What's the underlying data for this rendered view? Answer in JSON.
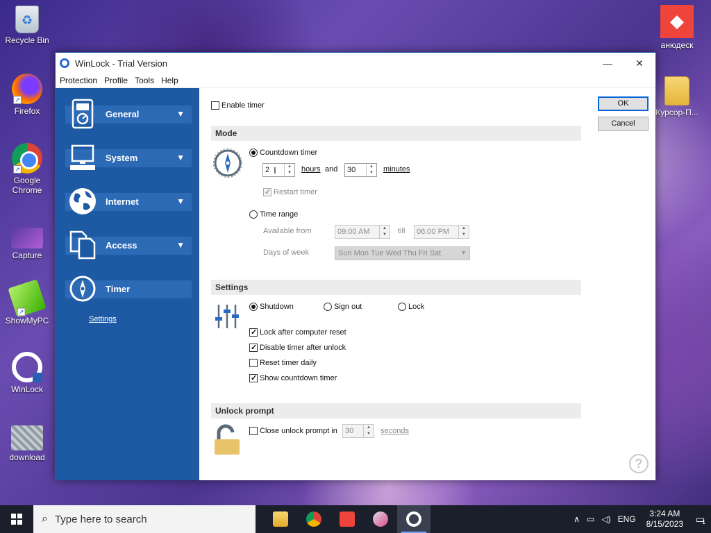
{
  "desktop": {
    "left_icons": [
      {
        "label": "Recycle Bin",
        "icon": "recycle-bin-icon"
      },
      {
        "label": "Firefox",
        "icon": "firefox-icon"
      },
      {
        "label": "Google Chrome",
        "icon": "chrome-icon"
      },
      {
        "label": "Capture",
        "icon": "capture-icon"
      },
      {
        "label": "ShowMyPC",
        "icon": "showmypc-icon"
      },
      {
        "label": "WinLock",
        "icon": "winlock-icon"
      },
      {
        "label": "download",
        "icon": "download-icon"
      }
    ],
    "right_icons": [
      {
        "label": "анюдеск",
        "icon": "anydesk-icon"
      },
      {
        "label": "Курсор-П...",
        "icon": "folder-icon"
      }
    ]
  },
  "window": {
    "title": "WinLock - Trial Version",
    "minimize": "—",
    "close": "✕",
    "menu": [
      "Protection",
      "Profile",
      "Tools",
      "Help"
    ]
  },
  "sidebar": {
    "items": [
      {
        "label": "General",
        "icon": "general-icon"
      },
      {
        "label": "System",
        "icon": "system-icon"
      },
      {
        "label": "Internet",
        "icon": "internet-icon"
      },
      {
        "label": "Access",
        "icon": "access-icon"
      },
      {
        "label": "Timer",
        "icon": "timer-icon"
      }
    ],
    "sub_link": "Settings"
  },
  "timer": {
    "enable_timer": "Enable timer",
    "mode_title": "Mode",
    "countdown_label": "Countdown timer",
    "hours_value": "2",
    "hours_label": "hours",
    "and_label": "and",
    "minutes_value": "30",
    "minutes_label": "minutes",
    "restart_timer": "Restart timer",
    "time_range_label": "Time range",
    "available_from_label": "Available from",
    "from_value": "09:00 AM",
    "till_label": "till",
    "till_value": "06:00 PM",
    "days_label": "Days of week",
    "days_value": "Sun Mon Tue Wed Thu Fri Sat",
    "settings_title": "Settings",
    "action_shutdown": "Shutdown",
    "action_signout": "Sign out",
    "action_lock": "Lock",
    "lock_after_reset": "Lock after computer reset",
    "disable_after_unlock": "Disable timer after unlock",
    "reset_daily": "Reset timer daily",
    "show_countdown": "Show countdown timer",
    "unlock_title": "Unlock prompt",
    "close_prompt_label": "Close unlock prompt in",
    "close_prompt_value": "30",
    "seconds_label": "seconds"
  },
  "buttons": {
    "ok": "OK",
    "cancel": "Cancel"
  },
  "taskbar": {
    "search_placeholder": "Type here to search",
    "language": "ENG",
    "time": "3:24 AM",
    "date": "8/15/2023",
    "notification_count": "1"
  }
}
